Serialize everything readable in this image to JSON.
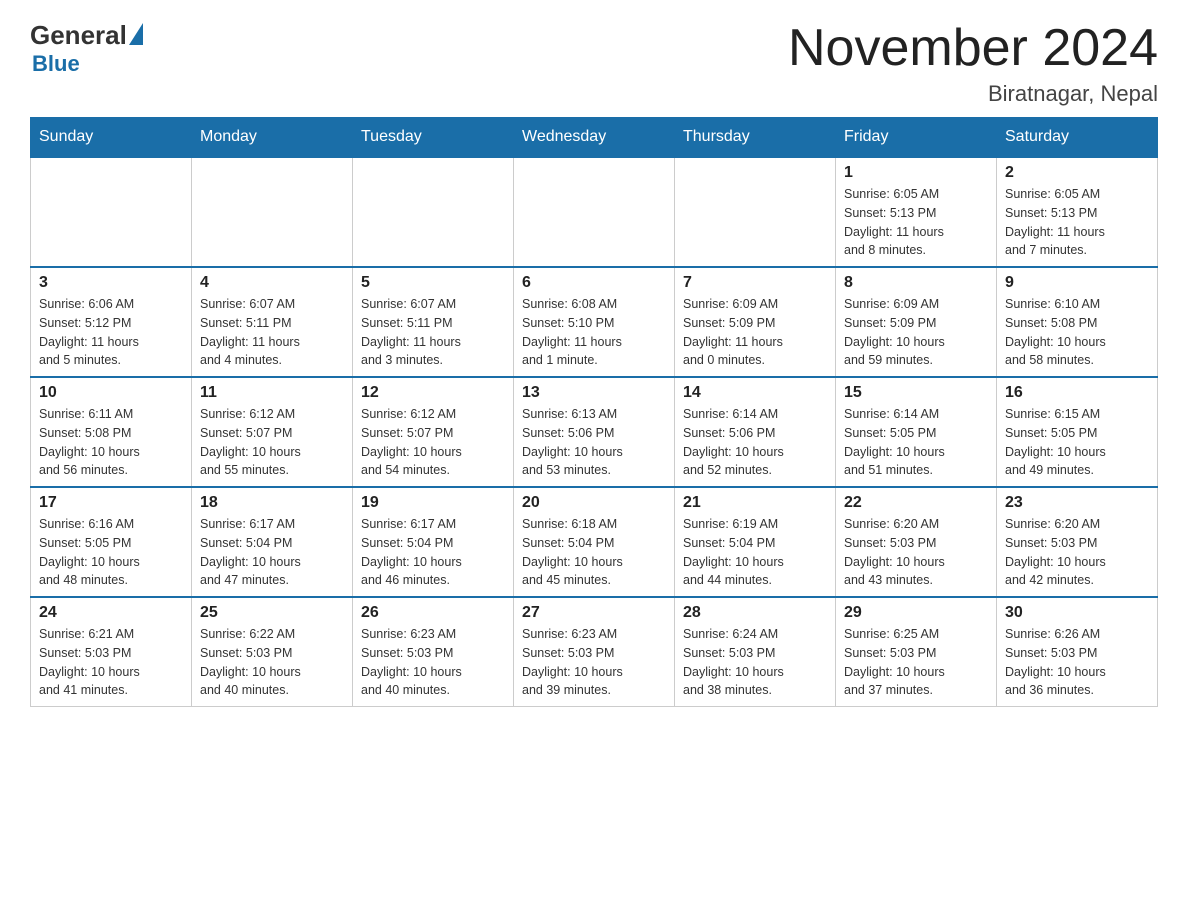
{
  "logo": {
    "general": "General",
    "blue": "Blue"
  },
  "title": {
    "month": "November 2024",
    "location": "Biratnagar, Nepal"
  },
  "weekdays": [
    "Sunday",
    "Monday",
    "Tuesday",
    "Wednesday",
    "Thursday",
    "Friday",
    "Saturday"
  ],
  "weeks": [
    [
      {
        "day": "",
        "info": ""
      },
      {
        "day": "",
        "info": ""
      },
      {
        "day": "",
        "info": ""
      },
      {
        "day": "",
        "info": ""
      },
      {
        "day": "",
        "info": ""
      },
      {
        "day": "1",
        "info": "Sunrise: 6:05 AM\nSunset: 5:13 PM\nDaylight: 11 hours\nand 8 minutes."
      },
      {
        "day": "2",
        "info": "Sunrise: 6:05 AM\nSunset: 5:13 PM\nDaylight: 11 hours\nand 7 minutes."
      }
    ],
    [
      {
        "day": "3",
        "info": "Sunrise: 6:06 AM\nSunset: 5:12 PM\nDaylight: 11 hours\nand 5 minutes."
      },
      {
        "day": "4",
        "info": "Sunrise: 6:07 AM\nSunset: 5:11 PM\nDaylight: 11 hours\nand 4 minutes."
      },
      {
        "day": "5",
        "info": "Sunrise: 6:07 AM\nSunset: 5:11 PM\nDaylight: 11 hours\nand 3 minutes."
      },
      {
        "day": "6",
        "info": "Sunrise: 6:08 AM\nSunset: 5:10 PM\nDaylight: 11 hours\nand 1 minute."
      },
      {
        "day": "7",
        "info": "Sunrise: 6:09 AM\nSunset: 5:09 PM\nDaylight: 11 hours\nand 0 minutes."
      },
      {
        "day": "8",
        "info": "Sunrise: 6:09 AM\nSunset: 5:09 PM\nDaylight: 10 hours\nand 59 minutes."
      },
      {
        "day": "9",
        "info": "Sunrise: 6:10 AM\nSunset: 5:08 PM\nDaylight: 10 hours\nand 58 minutes."
      }
    ],
    [
      {
        "day": "10",
        "info": "Sunrise: 6:11 AM\nSunset: 5:08 PM\nDaylight: 10 hours\nand 56 minutes."
      },
      {
        "day": "11",
        "info": "Sunrise: 6:12 AM\nSunset: 5:07 PM\nDaylight: 10 hours\nand 55 minutes."
      },
      {
        "day": "12",
        "info": "Sunrise: 6:12 AM\nSunset: 5:07 PM\nDaylight: 10 hours\nand 54 minutes."
      },
      {
        "day": "13",
        "info": "Sunrise: 6:13 AM\nSunset: 5:06 PM\nDaylight: 10 hours\nand 53 minutes."
      },
      {
        "day": "14",
        "info": "Sunrise: 6:14 AM\nSunset: 5:06 PM\nDaylight: 10 hours\nand 52 minutes."
      },
      {
        "day": "15",
        "info": "Sunrise: 6:14 AM\nSunset: 5:05 PM\nDaylight: 10 hours\nand 51 minutes."
      },
      {
        "day": "16",
        "info": "Sunrise: 6:15 AM\nSunset: 5:05 PM\nDaylight: 10 hours\nand 49 minutes."
      }
    ],
    [
      {
        "day": "17",
        "info": "Sunrise: 6:16 AM\nSunset: 5:05 PM\nDaylight: 10 hours\nand 48 minutes."
      },
      {
        "day": "18",
        "info": "Sunrise: 6:17 AM\nSunset: 5:04 PM\nDaylight: 10 hours\nand 47 minutes."
      },
      {
        "day": "19",
        "info": "Sunrise: 6:17 AM\nSunset: 5:04 PM\nDaylight: 10 hours\nand 46 minutes."
      },
      {
        "day": "20",
        "info": "Sunrise: 6:18 AM\nSunset: 5:04 PM\nDaylight: 10 hours\nand 45 minutes."
      },
      {
        "day": "21",
        "info": "Sunrise: 6:19 AM\nSunset: 5:04 PM\nDaylight: 10 hours\nand 44 minutes."
      },
      {
        "day": "22",
        "info": "Sunrise: 6:20 AM\nSunset: 5:03 PM\nDaylight: 10 hours\nand 43 minutes."
      },
      {
        "day": "23",
        "info": "Sunrise: 6:20 AM\nSunset: 5:03 PM\nDaylight: 10 hours\nand 42 minutes."
      }
    ],
    [
      {
        "day": "24",
        "info": "Sunrise: 6:21 AM\nSunset: 5:03 PM\nDaylight: 10 hours\nand 41 minutes."
      },
      {
        "day": "25",
        "info": "Sunrise: 6:22 AM\nSunset: 5:03 PM\nDaylight: 10 hours\nand 40 minutes."
      },
      {
        "day": "26",
        "info": "Sunrise: 6:23 AM\nSunset: 5:03 PM\nDaylight: 10 hours\nand 40 minutes."
      },
      {
        "day": "27",
        "info": "Sunrise: 6:23 AM\nSunset: 5:03 PM\nDaylight: 10 hours\nand 39 minutes."
      },
      {
        "day": "28",
        "info": "Sunrise: 6:24 AM\nSunset: 5:03 PM\nDaylight: 10 hours\nand 38 minutes."
      },
      {
        "day": "29",
        "info": "Sunrise: 6:25 AM\nSunset: 5:03 PM\nDaylight: 10 hours\nand 37 minutes."
      },
      {
        "day": "30",
        "info": "Sunrise: 6:26 AM\nSunset: 5:03 PM\nDaylight: 10 hours\nand 36 minutes."
      }
    ]
  ]
}
